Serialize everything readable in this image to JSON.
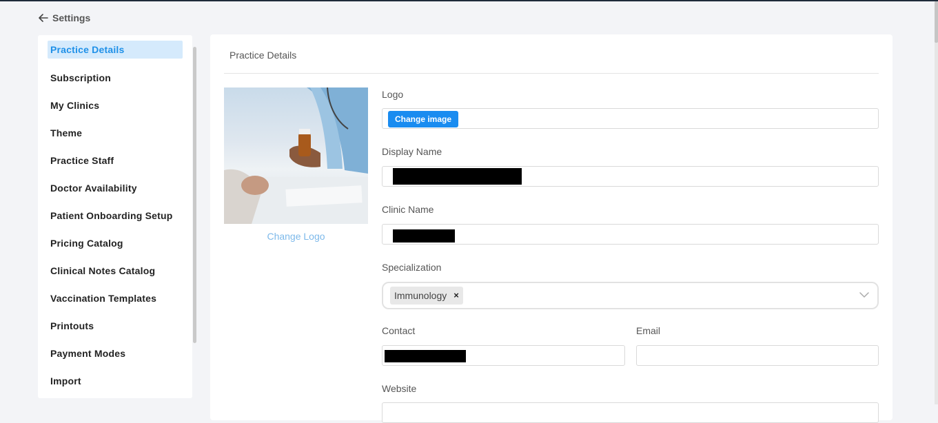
{
  "header": {
    "back_label": "Settings"
  },
  "sidebar": {
    "items": [
      {
        "label": "Practice Details",
        "active": true
      },
      {
        "label": "Subscription"
      },
      {
        "label": "My Clinics"
      },
      {
        "label": "Theme"
      },
      {
        "label": "Practice Staff"
      },
      {
        "label": "Doctor Availability"
      },
      {
        "label": "Patient Onboarding Setup"
      },
      {
        "label": "Pricing Catalog"
      },
      {
        "label": "Clinical Notes Catalog"
      },
      {
        "label": "Vaccination Templates"
      },
      {
        "label": "Printouts"
      },
      {
        "label": "Payment Modes"
      },
      {
        "label": "Import"
      }
    ]
  },
  "main": {
    "title": "Practice Details",
    "change_logo_link": "Change Logo",
    "form": {
      "logo_label": "Logo",
      "change_image_button": "Change image",
      "display_name_label": "Display Name",
      "clinic_name_label": "Clinic Name",
      "specialization_label": "Specialization",
      "specialization_selected": "Immunology",
      "remove_chip": "×",
      "contact_label": "Contact",
      "email_label": "Email",
      "website_label": "Website"
    }
  },
  "colors": {
    "accent": "#1a8cf0",
    "active_bg": "#d5eafc",
    "link": "#7db9ea"
  }
}
